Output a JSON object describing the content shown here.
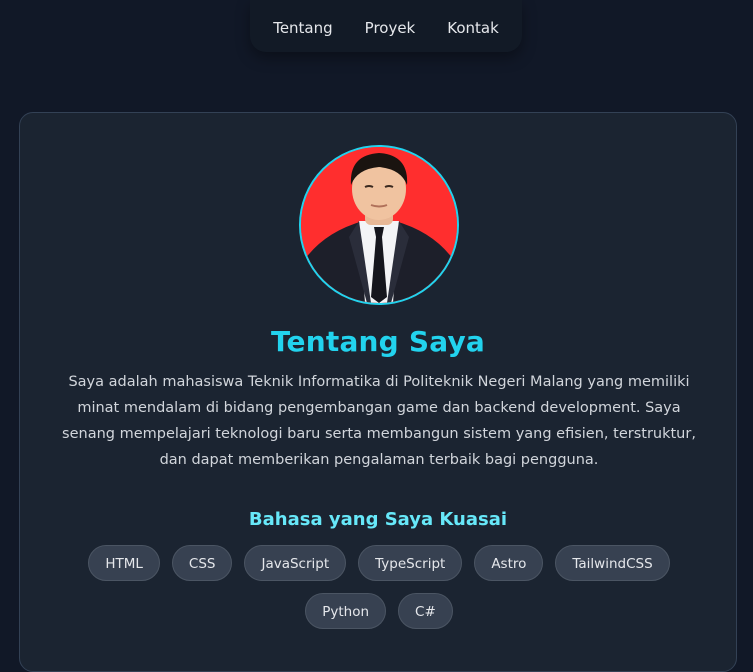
{
  "nav": {
    "items": [
      {
        "label": "Tentang"
      },
      {
        "label": "Proyek"
      },
      {
        "label": "Kontak"
      }
    ]
  },
  "about": {
    "title": "Tentang Saya",
    "description": "Saya adalah mahasiswa Teknik Informatika di Politeknik Negeri Malang yang memiliki minat mendalam di bidang pengembangan game dan backend development. Saya senang mempelajari teknologi baru serta membangun sistem yang efisien, terstruktur, dan dapat memberikan pengalaman terbaik bagi pengguna.",
    "photo_background": "#ff2e2e",
    "accent_color": "#22d3ee"
  },
  "skills": {
    "title": "Bahasa yang Saya Kuasai",
    "items": [
      "HTML",
      "CSS",
      "JavaScript",
      "TypeScript",
      "Astro",
      "TailwindCSS",
      "Python",
      "C#"
    ]
  }
}
